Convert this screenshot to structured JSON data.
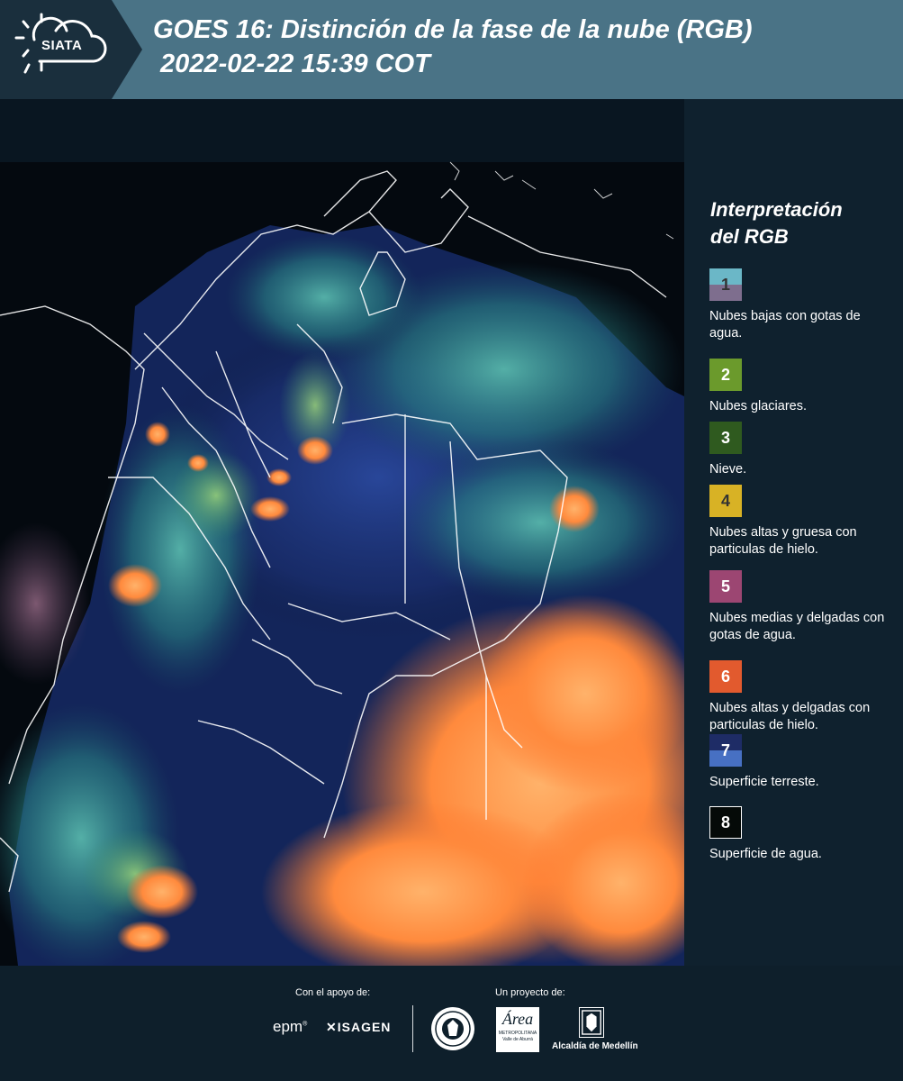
{
  "header": {
    "logo_text": "SIATA",
    "title_line1": "GOES 16: Distinción de la fase de la nube (RGB)",
    "title_line2": " 2022-02-22 15:39 COT"
  },
  "legend": {
    "title_line1": "Interpretación",
    "title_line2": "del RGB",
    "items": [
      {
        "num": "1",
        "label": "Nubes bajas con gotas de agua.",
        "color_top": "#6bb7c7",
        "color_bottom": "#7e6e8e",
        "text_color": "#333333"
      },
      {
        "num": "2",
        "label": "Nubes glaciares.",
        "color": "#6b9a2c",
        "text_color": "#ffffff"
      },
      {
        "num": "3",
        "label": "Nieve.",
        "color": "#2f5a1f",
        "text_color": "#ffffff"
      },
      {
        "num": "4",
        "label": "Nubes altas y gruesa con particulas de hielo.",
        "color": "#d8b225",
        "text_color": "#333333"
      },
      {
        "num": "5",
        "label": "Nubes medias y delgadas con gotas de agua.",
        "color": "#9c4672",
        "text_color": "#ffffff"
      },
      {
        "num": "6",
        "label": "Nubes altas y delgadas con particulas de hielo.",
        "color": "#e25a2e",
        "text_color": "#ffffff"
      },
      {
        "num": "7",
        "label": "Superficie terreste.",
        "color_top": "#1e2c66",
        "color_bottom": "#4770c3",
        "text_color": "#ffffff"
      },
      {
        "num": "8",
        "label": "Superficie de agua.",
        "color": "#050a08",
        "text_color": "#ffffff",
        "border": "#ffffff"
      }
    ]
  },
  "footer": {
    "support_label": "Con el apoyo de:",
    "project_label": "Un proyecto de:",
    "epm": "epm",
    "isagen": "ISAGEN",
    "area_main": "Área",
    "area_sub": "METROPOLITANA",
    "area_sub2": "Valle de Aburrá",
    "alcaldia": "Alcaldía de Medellín"
  }
}
